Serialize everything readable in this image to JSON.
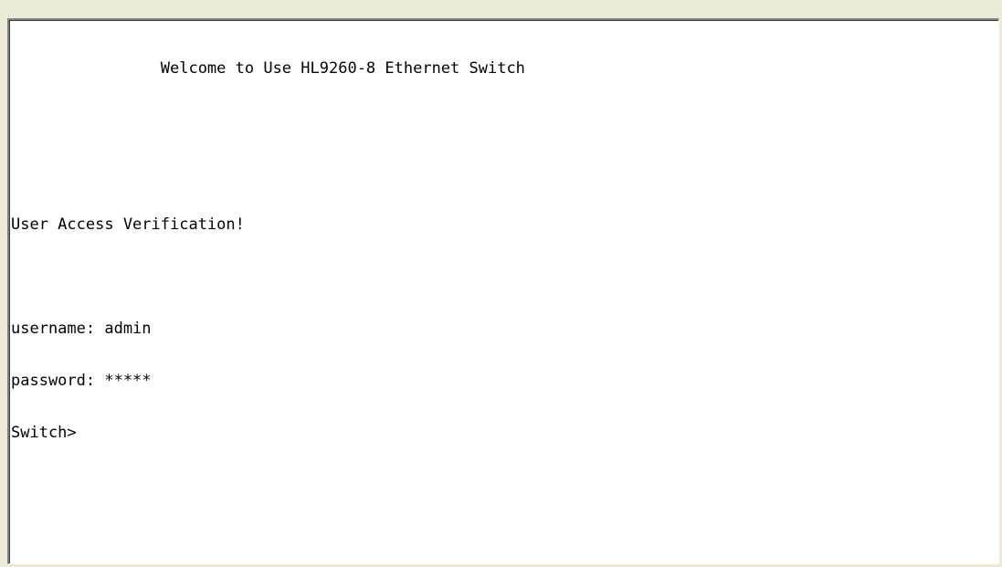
{
  "terminal": {
    "banner": "                Welcome to Use HL9260-8 Ethernet Switch",
    "verification": "User Access Verification!",
    "username_line": "username: admin",
    "password_line": "password: *****",
    "prompt": "Switch>"
  }
}
